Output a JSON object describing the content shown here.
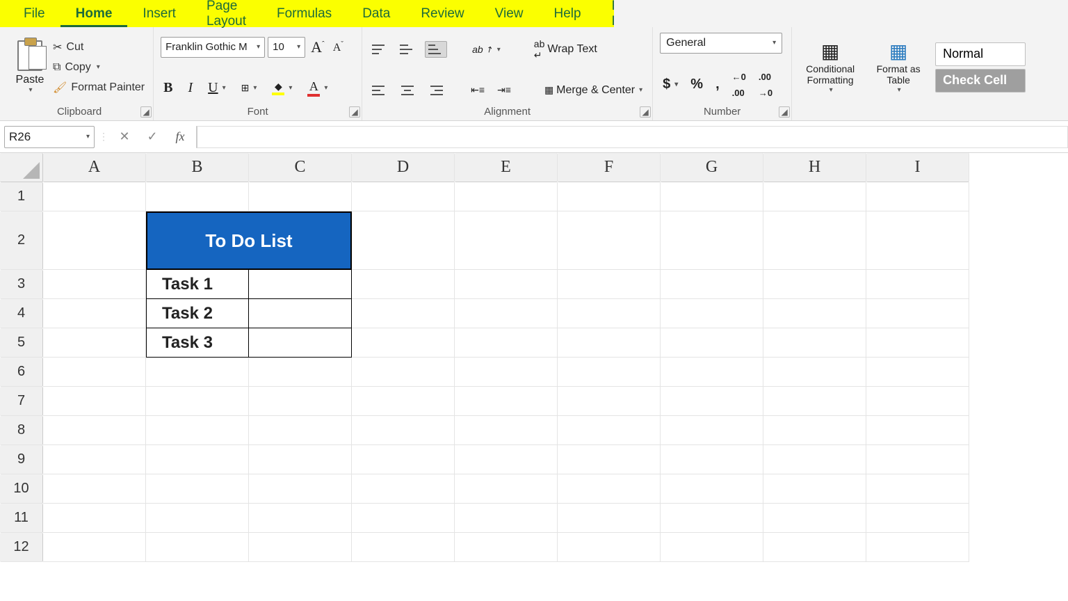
{
  "tabs": {
    "file": "File",
    "home": "Home",
    "insert": "Insert",
    "page_layout": "Page Layout",
    "formulas": "Formulas",
    "data": "Data",
    "review": "Review",
    "view": "View",
    "help": "Help",
    "power_pivot": "Power Pivot",
    "active": "Home"
  },
  "ribbon": {
    "clipboard": {
      "label": "Clipboard",
      "paste": "Paste",
      "cut": "Cut",
      "copy": "Copy",
      "format_painter": "Format Painter"
    },
    "font": {
      "label": "Font",
      "name": "Franklin Gothic M",
      "size": "10"
    },
    "alignment": {
      "label": "Alignment",
      "wrap_text": "Wrap Text",
      "merge_center": "Merge & Center"
    },
    "number": {
      "label": "Number",
      "format": "General"
    },
    "styles": {
      "conditional": "Conditional Formatting",
      "format_table": "Format as Table",
      "normal": "Normal",
      "check_cell": "Check Cell"
    }
  },
  "formula_bar": {
    "name_box": "R26",
    "formula": ""
  },
  "grid": {
    "columns": [
      "A",
      "B",
      "C",
      "D",
      "E",
      "F",
      "G",
      "H",
      "I"
    ],
    "rows": [
      "1",
      "2",
      "3",
      "4",
      "5",
      "6",
      "7",
      "8",
      "9",
      "10",
      "11",
      "12"
    ]
  },
  "todo": {
    "title": "To Do List",
    "tasks": [
      "Task 1",
      "Task 2",
      "Task 3"
    ]
  }
}
